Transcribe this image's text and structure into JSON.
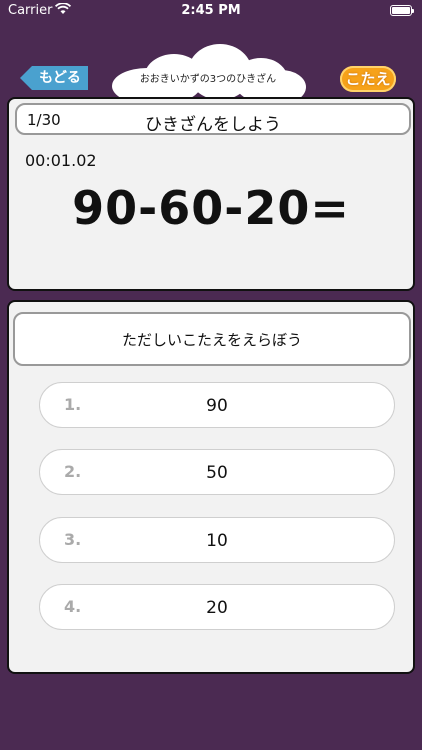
{
  "status_bar": {
    "carrier": "Carrier",
    "time": "2:45 PM"
  },
  "header": {
    "back_label": "もどる",
    "title": "おおきいかずの3つのひきざん",
    "answer_label": "こたえ"
  },
  "question": {
    "counter": "1/30",
    "heading": "ひきざんをしよう",
    "timer": "00:01.02",
    "equation": "90-60-20="
  },
  "answers": {
    "instruction": "ただしいこたえをえらぼう",
    "choices": [
      {
        "number": "1.",
        "value": "90"
      },
      {
        "number": "2.",
        "value": "50"
      },
      {
        "number": "3.",
        "value": "10"
      },
      {
        "number": "4.",
        "value": "20"
      }
    ]
  }
}
